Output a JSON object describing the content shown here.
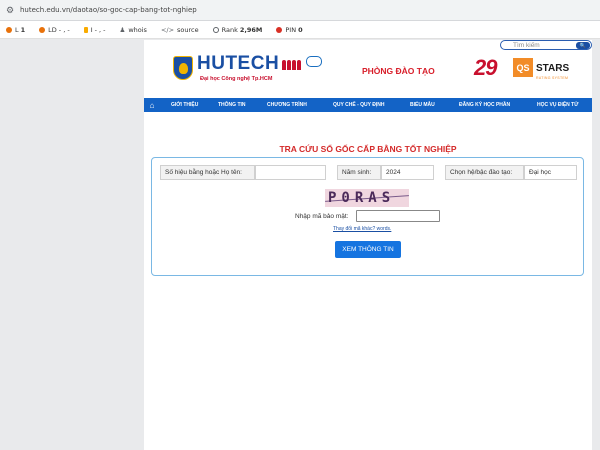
{
  "browser": {
    "url": "hutech.edu.vn/daotao/so-goc-cap-bang-tot-nghiep",
    "extensions": [
      {
        "prefix": "L",
        "value": "1",
        "color": "#e8710a"
      },
      {
        "prefix": "LD",
        "value": "- , -",
        "color": "#e8710a"
      },
      {
        "prefix": "I",
        "value": "- , -",
        "color": "#f9ab00"
      },
      {
        "prefix": "",
        "value": "whois",
        "color": "#5f6368"
      },
      {
        "prefix": "",
        "value": "source",
        "color": "#5f6368"
      },
      {
        "prefix": "Rank",
        "value": "2,96M",
        "color": "#5f6368"
      },
      {
        "prefix": "PIN",
        "value": "0",
        "color": "#d93025"
      }
    ]
  },
  "search": {
    "placeholder": "Tìm kiếm"
  },
  "header": {
    "brand": "HUTECH",
    "brand_sub": "Đại học Công nghệ Tp.HCM",
    "department": "PHÒNG ĐÀO TẠO",
    "anniversary": "29",
    "qs": "QS",
    "stars": "STARS",
    "stars_sub": "RATING SYSTEM"
  },
  "nav": {
    "items": [
      "GIỚI THIỆU",
      "THÔNG TIN",
      "CHƯƠNG TRÌNH",
      "QUY CHẾ - QUY ĐỊNH",
      "BIỂU MẪU",
      "ĐĂNG KÝ HỌC PHẦN",
      "HỌC VỤ ĐIỆN TỬ"
    ]
  },
  "form": {
    "title": "TRA CỨU SỔ GỐC CẤP BẰNG TỐT NGHIỆP",
    "id_label": "Số hiệu bằng hoặc Họ tên:",
    "id_value": "",
    "year_label": "Năm sinh:",
    "year_value": "2024",
    "level_label": "Chọn hệ/bậc đào tạo:",
    "level_value": "Đại học",
    "captcha_text": "P0RAS",
    "captcha_label": "Nhập mã bảo mật:",
    "captcha_value": "",
    "captcha_change": "Thay đổi mã khác? words.",
    "submit": "XEM THÔNG TIN"
  }
}
